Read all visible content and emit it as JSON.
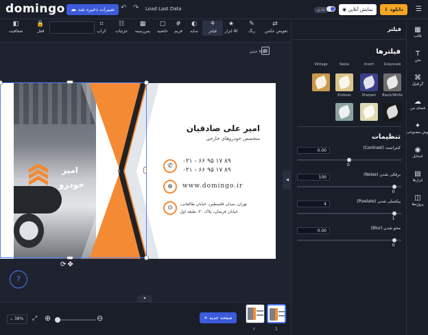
{
  "app": {
    "logo": "domingo",
    "save_status": "تغییرات ذخیره شد",
    "load_last": "Load Last Data"
  },
  "topbar": {
    "toggle_label": "عادی",
    "online_label": "نمایش آنلاین",
    "download_label": "دانلود"
  },
  "toolbar": {
    "tools": [
      {
        "name": "change-photo",
        "icon": "⇄",
        "label": "تعویض عکس"
      },
      {
        "name": "color",
        "icon": "✎",
        "label": "رنگ"
      },
      {
        "name": "ai-tools",
        "icon": "★",
        "label": "ابزار AI"
      },
      {
        "name": "filter",
        "icon": "⚘",
        "label": "فیلتر"
      },
      {
        "name": "shadow",
        "icon": "◐",
        "label": "سایه"
      },
      {
        "name": "frame",
        "icon": "#",
        "label": "فریم"
      },
      {
        "name": "border",
        "icon": "▢",
        "label": "حاشیه"
      },
      {
        "name": "background",
        "icon": "▦",
        "label": "پس‌زمینه"
      },
      {
        "name": "details",
        "icon": "☷",
        "label": "جزئیات"
      },
      {
        "name": "crop",
        "icon": "⌗",
        "label": "کراپ"
      },
      {
        "name": "lock",
        "icon": "🔒",
        "label": "قفل"
      },
      {
        "name": "opacity",
        "icon": "◧",
        "label": "شفافیت"
      }
    ]
  },
  "canvas": {
    "size_label": "حجم MB",
    "card": {
      "brand_line1": "امیر",
      "brand_line2": "خودرو",
      "person_name": "امیر علی صادقیان",
      "person_title": "متخصص خودروهای خارجی",
      "phone1": "۰۲۱ - ۶۶ ۹۵ ۱۷ ۸۹",
      "phone2": "۰۲۱ - ۶۶ ۹۵ ۱۷ ۸۹",
      "website": "www.domingo.ir",
      "address1": "تهران، میدان فلسطین، خیابان طالقانی،",
      "address2": "خیابان فریمان، پلاک ۳۰، طبقه اول",
      "accent": "#f58a34"
    },
    "help_label": "?"
  },
  "bottombar": {
    "zoom": "38%",
    "new_page": "صفحه جدید",
    "pages": [
      "1",
      "۲"
    ]
  },
  "panel": {
    "title": "فیلتر",
    "filters_title": "فیلترها",
    "filters_row1": [
      {
        "label": "Grayscale",
        "color": "#6d6d6d"
      },
      {
        "label": "Invert",
        "color": "#3b3f8a"
      },
      {
        "label": "Sepia",
        "color": "#d9c48a"
      },
      {
        "label": "Vintage",
        "color": "#c99a4a"
      }
    ],
    "filters_row2": [
      {
        "label": "Black/White",
        "color": "#1a1a1a"
      },
      {
        "label": "Sharpen",
        "color": "#e0d9b0"
      },
      {
        "label": "Emboss",
        "color": "#8aa3a0"
      }
    ],
    "settings_title": "تنظیمات",
    "adjustments": [
      {
        "label": "کنتراست (Contrast)",
        "input": "0.00",
        "value": "0",
        "fraction": 0.5
      },
      {
        "label": "برفکی شدن (Noise)",
        "input": "100",
        "value": "0",
        "fraction": 0.95
      },
      {
        "label": "پیکسلی شدن (Pixelate)",
        "input": "4",
        "value": "1",
        "fraction": 0.95
      },
      {
        "label": "محو شدن (Blur)",
        "input": "0.00",
        "value": "0",
        "fraction": 0.95
      }
    ]
  },
  "rail": [
    {
      "icon": "▦",
      "label": "قالب"
    },
    {
      "icon": "T",
      "label": "متن"
    },
    {
      "icon": "⌘",
      "label": "گرافیک"
    },
    {
      "icon": "☁",
      "label": "فضای من"
    },
    {
      "icon": "✦",
      "label": "هوش مصنوعی"
    },
    {
      "icon": "◉",
      "label": "استایل"
    },
    {
      "icon": "▤",
      "label": "ابزارها"
    },
    {
      "icon": "◫",
      "label": "پروژه‌ها"
    }
  ]
}
